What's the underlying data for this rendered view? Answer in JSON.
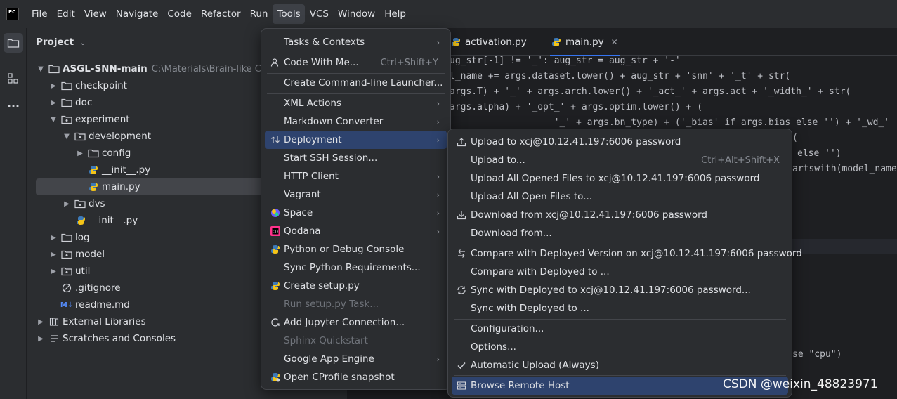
{
  "menubar": {
    "logo_text": "PC",
    "items": [
      "File",
      "Edit",
      "View",
      "Navigate",
      "Code",
      "Refactor",
      "Run",
      "Tools",
      "VCS",
      "Window",
      "Help"
    ],
    "active": "Tools"
  },
  "project": {
    "title": "Project",
    "tree": [
      {
        "label": "ASGL-SNN-main",
        "path": "C:\\Materials\\Brain-like Com"
      },
      {
        "label": "checkpoint"
      },
      {
        "label": "doc"
      },
      {
        "label": "experiment"
      },
      {
        "label": "development"
      },
      {
        "label": "config"
      },
      {
        "label": "__init__.py"
      },
      {
        "label": "main.py"
      },
      {
        "label": "dvs"
      },
      {
        "label": "__init__.py"
      },
      {
        "label": "log"
      },
      {
        "label": "model"
      },
      {
        "label": "util"
      },
      {
        "label": ".gitignore"
      },
      {
        "label": "readme.md"
      },
      {
        "label": "External Libraries"
      },
      {
        "label": "Scratches and Consoles"
      }
    ]
  },
  "editor": {
    "tabs": [
      {
        "label": "activation.py"
      },
      {
        "label": "main.py"
      }
    ],
    "code_lines": [
      "ug_str[-1] != '_': aug_str = aug_str + '-'",
      "l_name += args.dataset.lower() + aug_str + 'snn' + '_t' + str(",
      "args.T) + '_' + args.arch.lower() + '_act_' + args.act + '_width_' + str(",
      "args.alpha) + '_opt_' + args.optim.lower() + (",
      "                   '_' + args.bn_type) + ('_bias' if args.bias else '') + '_wd_'",
      "(",
      "else '')",
      "artswith(model_name",
      "se \"cpu\")"
    ]
  },
  "tools_menu": {
    "items": [
      {
        "label": "Tasks & Contexts",
        "submenu": true
      },
      {
        "label": "Code With Me...",
        "shortcut": "Ctrl+Shift+Y"
      },
      {
        "label": "Create Command-line Launcher..."
      },
      {
        "label": "XML Actions",
        "submenu": true
      },
      {
        "label": "Markdown Converter",
        "submenu": true
      },
      {
        "label": "Deployment",
        "submenu": true
      },
      {
        "label": "Start SSH Session..."
      },
      {
        "label": "HTTP Client",
        "submenu": true
      },
      {
        "label": "Vagrant",
        "submenu": true
      },
      {
        "label": "Space",
        "submenu": true
      },
      {
        "label": "Qodana",
        "submenu": true
      },
      {
        "label": "Python or Debug Console"
      },
      {
        "label": "Sync Python Requirements..."
      },
      {
        "label": "Create setup.py"
      },
      {
        "label": "Run setup.py Task..."
      },
      {
        "label": "Add Jupyter Connection..."
      },
      {
        "label": "Sphinx Quickstart"
      },
      {
        "label": "Google App Engine",
        "submenu": true
      },
      {
        "label": "Open CProfile snapshot"
      }
    ]
  },
  "deployment_menu": {
    "items": [
      {
        "label": "Upload to xcj@10.12.41.197:6006 password"
      },
      {
        "label": "Upload to...",
        "shortcut": "Ctrl+Alt+Shift+X"
      },
      {
        "label": "Upload All Opened Files to xcj@10.12.41.197:6006 password"
      },
      {
        "label": "Upload All Open Files to..."
      },
      {
        "label": "Download from xcj@10.12.41.197:6006 password"
      },
      {
        "label": "Download from..."
      },
      {
        "label": "Compare with Deployed Version on xcj@10.12.41.197:6006 password"
      },
      {
        "label": "Compare with Deployed to ..."
      },
      {
        "label": "Sync with Deployed to xcj@10.12.41.197:6006 password..."
      },
      {
        "label": "Sync with Deployed to ..."
      },
      {
        "label": "Configuration..."
      },
      {
        "label": "Options..."
      },
      {
        "label": "Automatic Upload (Always)"
      },
      {
        "label": "Browse Remote Host"
      }
    ]
  },
  "watermark": "CSDN @weixin_48823971",
  "colors": {
    "accent": "#3574f0",
    "selection": "#2e436e",
    "background": "#1e1f22",
    "panel": "#2b2d30"
  }
}
